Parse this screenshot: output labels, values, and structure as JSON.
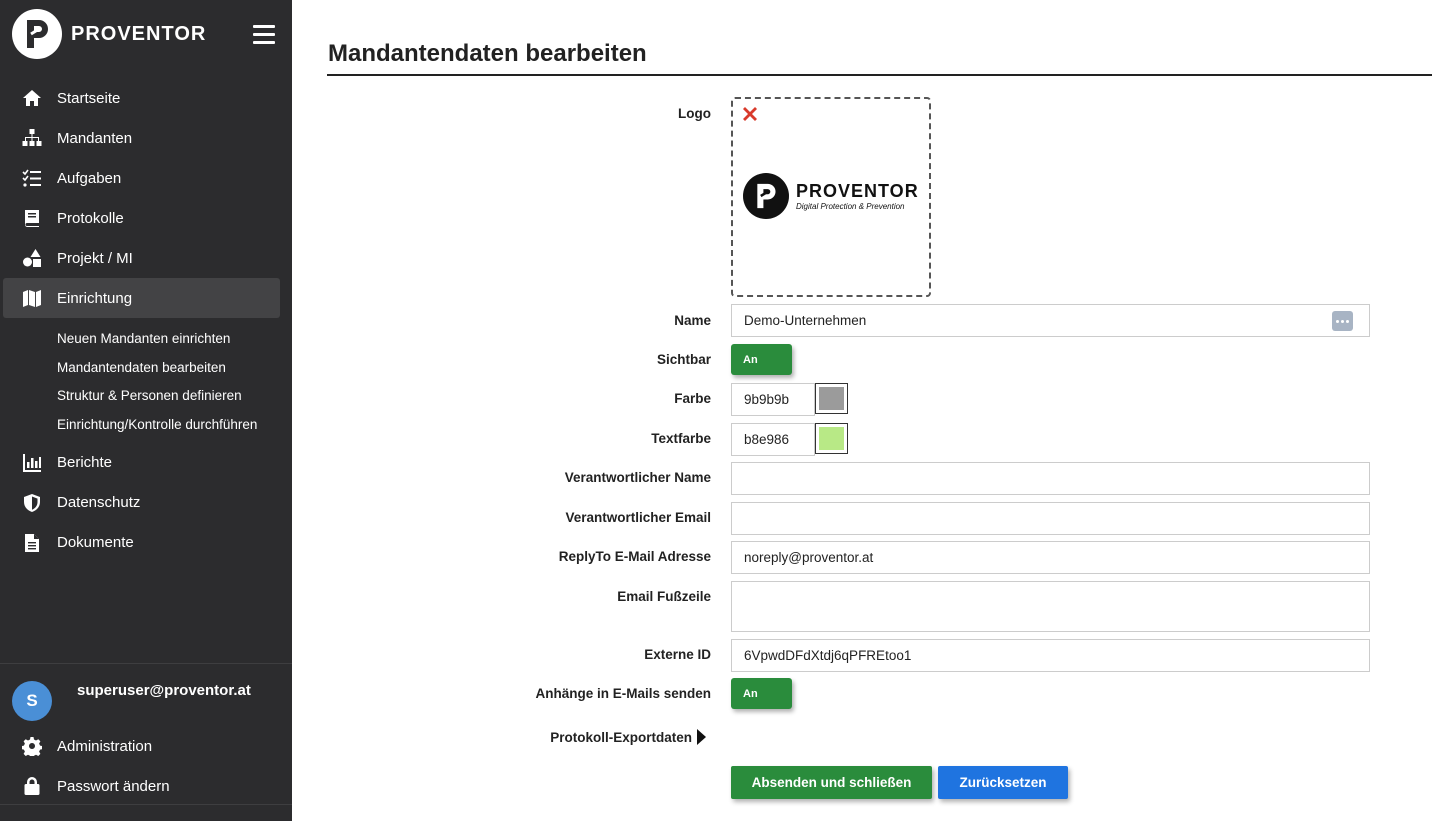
{
  "brand": {
    "name": "PROVENTOR"
  },
  "nav": {
    "items": [
      {
        "label": "Startseite",
        "icon": "home-icon"
      },
      {
        "label": "Mandanten",
        "icon": "sitemap-icon"
      },
      {
        "label": "Aufgaben",
        "icon": "tasks-icon"
      },
      {
        "label": "Protokolle",
        "icon": "book-icon"
      },
      {
        "label": "Projekt / MI",
        "icon": "shapes-icon"
      },
      {
        "label": "Einrichtung",
        "icon": "map-icon"
      }
    ],
    "sub": [
      {
        "label": "Neuen Mandanten einrichten"
      },
      {
        "label": "Mandantendaten bearbeiten"
      },
      {
        "label": "Struktur & Personen definieren"
      },
      {
        "label": "Einrichtung/Kontrolle durchführen"
      }
    ],
    "more": [
      {
        "label": "Berichte",
        "icon": "chart-icon"
      },
      {
        "label": "Datenschutz",
        "icon": "shield-icon"
      },
      {
        "label": "Dokumente",
        "icon": "document-icon"
      }
    ]
  },
  "user": {
    "initial": "S",
    "email": "superuser@proventor.at",
    "admin_label": "Administration",
    "password_label": "Passwort ändern"
  },
  "page": {
    "title": "Mandantendaten bearbeiten"
  },
  "form": {
    "logo_label": "Logo",
    "logo_brand": "PROVENTOR",
    "logo_tagline": "Digital Protection & Prevention",
    "name_label": "Name",
    "name_value": "Demo-Unternehmen",
    "visible_label": "Sichtbar",
    "visible_value": "An",
    "color_label": "Farbe",
    "color_value": "9b9b9b",
    "color_swatch": "#9b9b9b",
    "textcolor_label": "Textfarbe",
    "textcolor_value": "b8e986",
    "textcolor_swatch": "#b8e986",
    "resp_name_label": "Verantwortlicher Name",
    "resp_name_value": "",
    "resp_email_label": "Verantwortlicher Email",
    "resp_email_value": "",
    "replyto_label": "ReplyTo E-Mail Adresse",
    "replyto_value": "noreply@proventor.at",
    "footer_label": "Email Fußzeile",
    "external_id_label": "Externe ID",
    "external_id_value": "6VpwdDFdXtdj6qPFREtoo1",
    "attachments_label": "Anhänge in E-Mails senden",
    "attachments_value": "An",
    "export_label": "Protokoll-Exportdaten",
    "submit_label": "Absenden und schließen",
    "reset_label": "Zurücksetzen"
  },
  "colors": {
    "sidebar_bg": "#2c2c2e",
    "success": "#2a8c3c",
    "primary": "#1f74e0",
    "avatar": "#4a8fd6",
    "remove": "#d93a2b"
  }
}
